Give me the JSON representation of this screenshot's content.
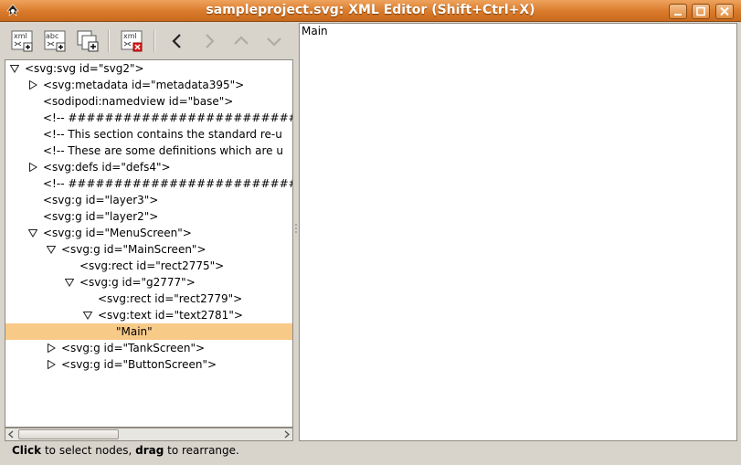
{
  "window": {
    "title": "sampleproject.svg: XML Editor (Shift+Ctrl+X)",
    "colors": {
      "titlebar": "#d97a2a",
      "selection": "#f8ca88"
    }
  },
  "toolbar": {
    "new_element_label": "xml",
    "new_text_label": "abc",
    "icons": [
      "new-element-node-icon",
      "new-text-node-icon",
      "duplicate-node-icon",
      "delete-node-icon",
      "unindent-icon",
      "indent-icon",
      "raise-node-icon",
      "lower-node-icon"
    ]
  },
  "tree": {
    "nodes": [
      {
        "text": "<svg:svg id=\"svg2\">",
        "expander": "expanded"
      },
      {
        "text": "<svg:metadata id=\"metadata395\">",
        "expander": "collapsed"
      },
      {
        "text": "<sodipodi:namedview id=\"base\">",
        "expander": "none"
      },
      {
        "text": "<!-- ###########################",
        "expander": "none"
      },
      {
        "text": "<!-- This section contains the standard re-u",
        "expander": "none"
      },
      {
        "text": "<!-- These are some definitions which are u",
        "expander": "none"
      },
      {
        "text": "<svg:defs id=\"defs4\">",
        "expander": "collapsed"
      },
      {
        "text": "<!-- ###########################",
        "expander": "none"
      },
      {
        "text": "<svg:g id=\"layer3\">",
        "expander": "none"
      },
      {
        "text": "<svg:g id=\"layer2\">",
        "expander": "none"
      },
      {
        "text": "<svg:g id=\"MenuScreen\">",
        "expander": "expanded"
      },
      {
        "text": "<svg:g id=\"MainScreen\">",
        "expander": "expanded"
      },
      {
        "text": "<svg:rect id=\"rect2775\">",
        "expander": "none"
      },
      {
        "text": "<svg:g id=\"g2777\">",
        "expander": "expanded"
      },
      {
        "text": "<svg:rect id=\"rect2779\">",
        "expander": "none"
      },
      {
        "text": "<svg:text id=\"text2781\">",
        "expander": "expanded"
      },
      {
        "text": "\"Main\"",
        "expander": "none",
        "selected": true
      },
      {
        "text": "<svg:g id=\"TankScreen\">",
        "expander": "collapsed"
      },
      {
        "text": "<svg:g id=\"ButtonScreen\">",
        "expander": "collapsed"
      }
    ]
  },
  "content": {
    "text": "Main"
  },
  "status": {
    "click": "Click",
    "click_rest": " to select nodes, ",
    "drag": "drag",
    "drag_rest": " to rearrange."
  }
}
